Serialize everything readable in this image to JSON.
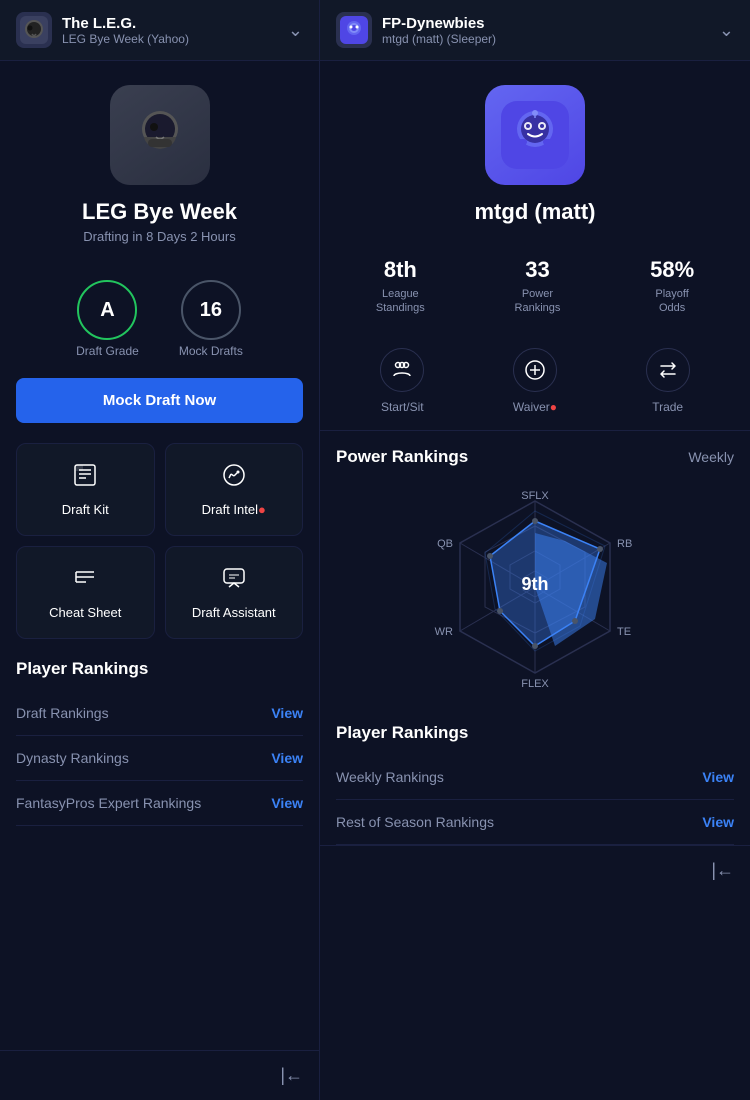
{
  "left": {
    "header": {
      "title": "The L.E.G.",
      "subtitle": "LEG Bye Week (Yahoo)"
    },
    "hero": {
      "title": "LEG Bye Week",
      "subtitle": "Drafting in 8 Days 2 Hours"
    },
    "stats": {
      "grade": {
        "value": "A",
        "label": "Draft Grade"
      },
      "mocks": {
        "value": "16",
        "label": "Mock Drafts"
      }
    },
    "mock_draft_button": "Mock Draft Now",
    "tools": [
      {
        "label": "Draft Kit",
        "icon": "📋"
      },
      {
        "label": "Draft Intel",
        "icon": "📊",
        "dot": true
      },
      {
        "label": "Cheat Sheet",
        "icon": "☰"
      },
      {
        "label": "Draft Assistant",
        "icon": "💬"
      }
    ],
    "rankings_title": "Player Rankings",
    "rankings": [
      {
        "label": "Draft Rankings",
        "link": "View"
      },
      {
        "label": "Dynasty Rankings",
        "link": "View"
      },
      {
        "label": "FantasyPros Expert Rankings",
        "link": "View"
      }
    ]
  },
  "right": {
    "header": {
      "title": "FP-Dynewbies",
      "subtitle": "mtgd (matt) (Sleeper)"
    },
    "hero": {
      "title": "mtgd (matt)"
    },
    "stats": [
      {
        "value": "8th",
        "label": "League\nStandings"
      },
      {
        "value": "33",
        "label": "Power\nRankings"
      },
      {
        "value": "58%",
        "label": "Playoff\nOdds"
      }
    ],
    "tools": [
      {
        "label": "Start/Sit",
        "icon": "👥"
      },
      {
        "label": "Waiver",
        "icon": "+",
        "dot": true
      },
      {
        "label": "Trade",
        "icon": "⇄"
      }
    ],
    "power_rankings_title": "Power Rankings",
    "weekly_label": "Weekly",
    "radar": {
      "rank": "9th",
      "labels": [
        "SFLX",
        "RB",
        "TE",
        "FLEX",
        "WR",
        "QB"
      ]
    },
    "rankings_title": "Player Rankings",
    "rankings": [
      {
        "label": "Weekly Rankings",
        "link": "View"
      },
      {
        "label": "Rest of Season Rankings",
        "link": "View"
      }
    ]
  }
}
